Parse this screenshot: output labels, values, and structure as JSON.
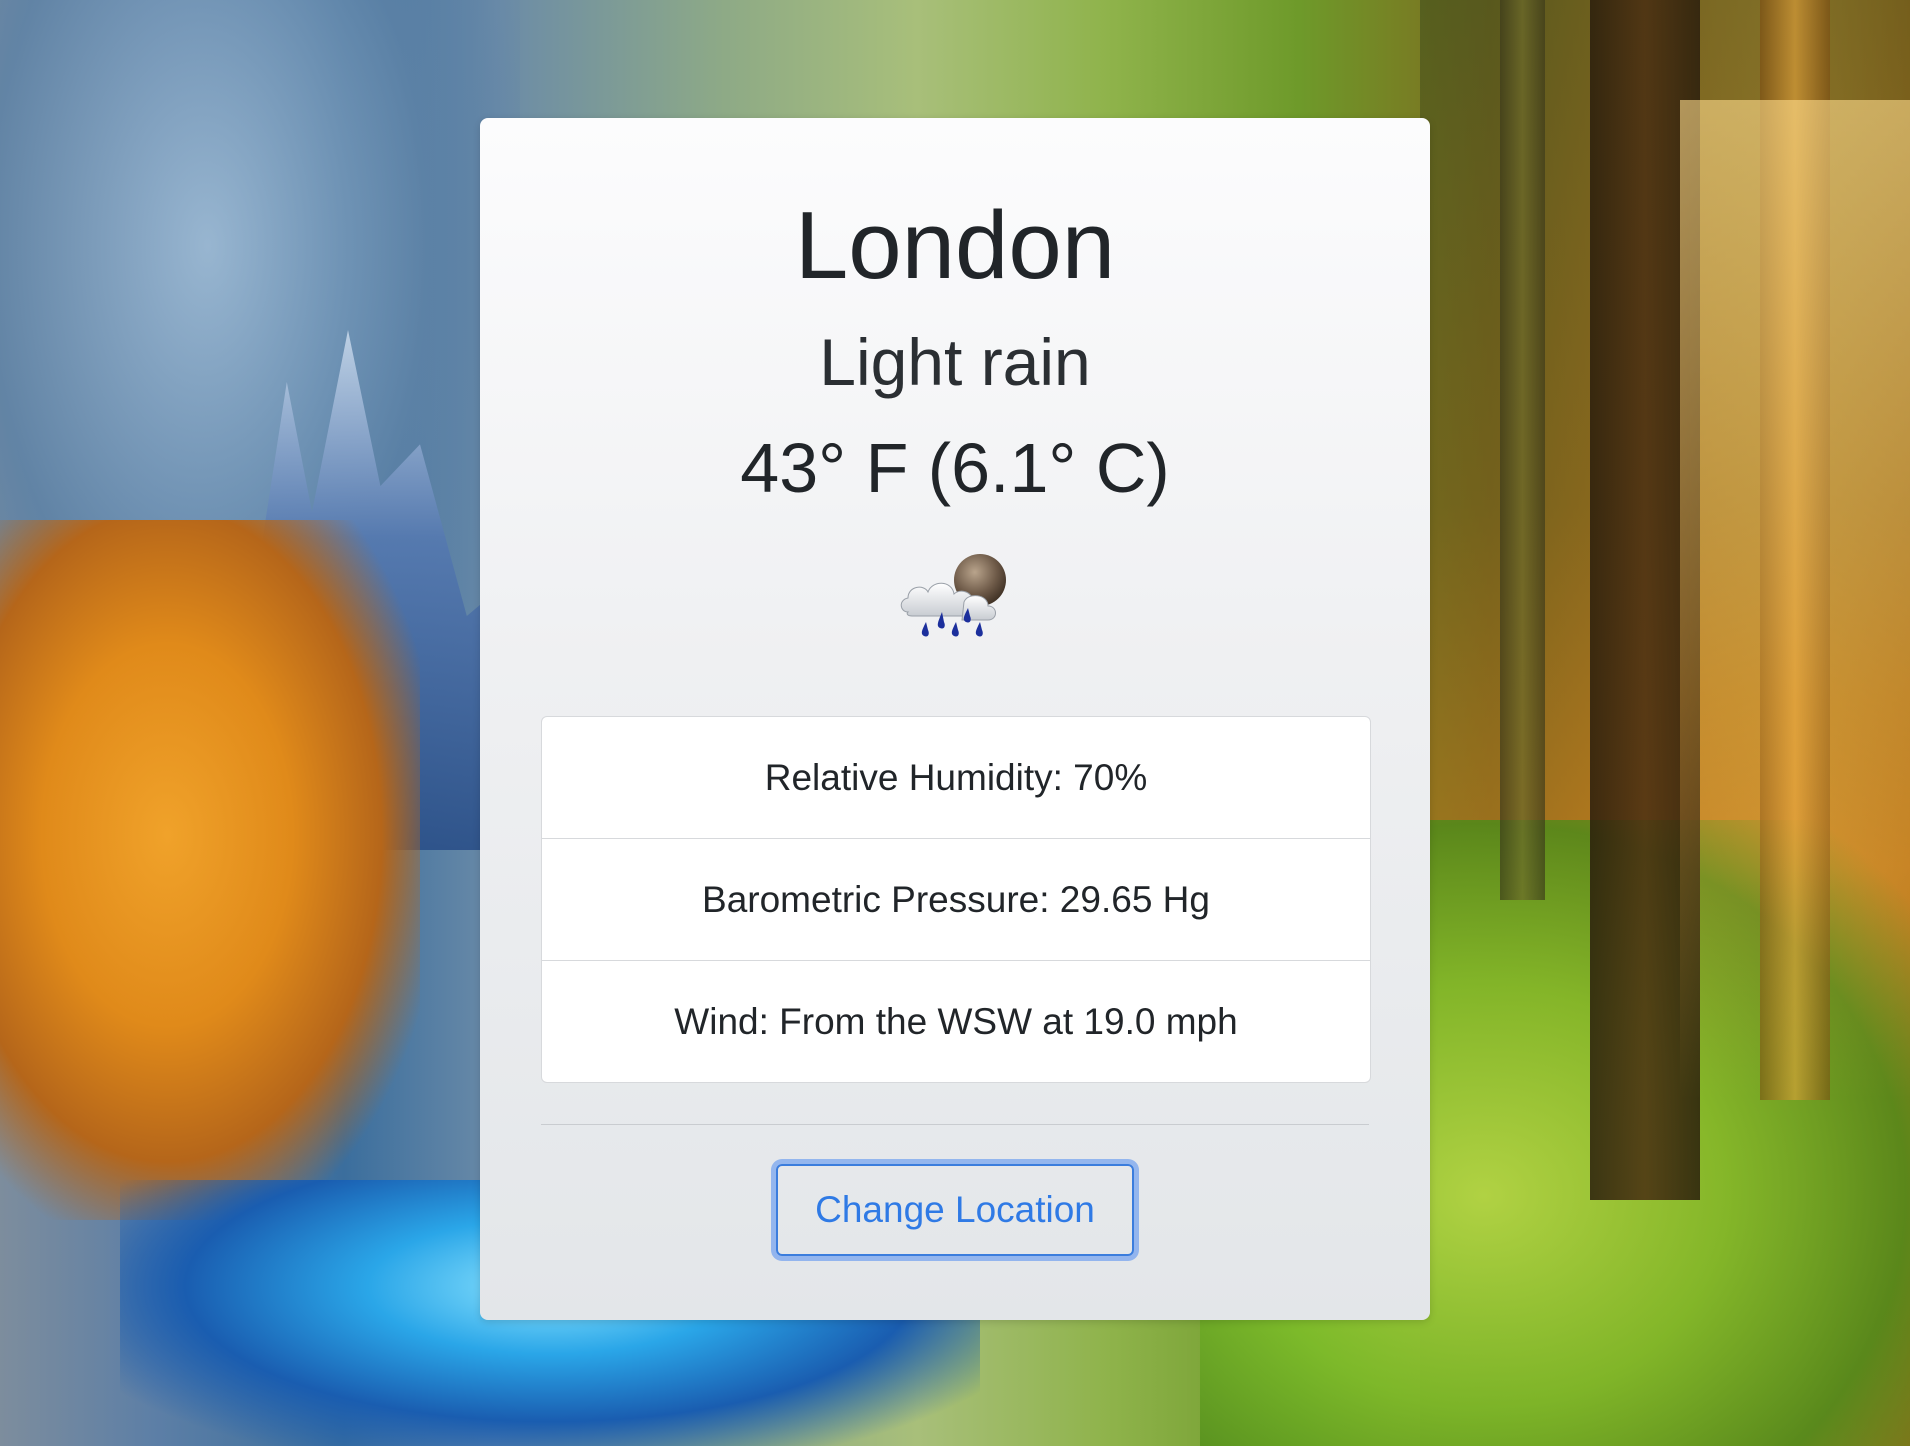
{
  "weather": {
    "city": "London",
    "condition": "Light rain",
    "temperature": "43° F (6.1° C)",
    "icon": "rain-cloud-moon-icon"
  },
  "details": {
    "humidity": "Relative Humidity: 70%",
    "pressure": "Barometric Pressure: 29.65 Hg",
    "wind": "Wind: From the WSW at 19.0 mph"
  },
  "actions": {
    "change_location_label": "Change Location"
  },
  "colors": {
    "primary": "#2f7ae5",
    "text": "#212529",
    "card_top": "#fcfcfd",
    "card_bottom": "#e3e6e9"
  }
}
